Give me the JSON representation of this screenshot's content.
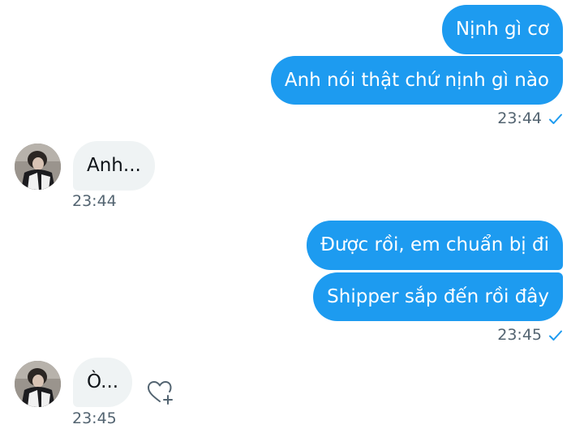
{
  "conversation": {
    "msg1": {
      "text": "Nịnh gì cơ"
    },
    "msg2": {
      "text": "Anh nói thật chứ nịnh gì nào"
    },
    "time1": "23:44",
    "msg3": {
      "text": "Anh..."
    },
    "time2": "23:44",
    "msg4": {
      "text": "Được rồi, em chuẩn bị đi"
    },
    "msg5": {
      "text": "Shipper sắp đến rồi đây"
    },
    "time3": "23:45",
    "msg6": {
      "text": "Ò..."
    },
    "time4": "23:45"
  },
  "colors": {
    "outgoing_bubble": "#1d9bf0",
    "incoming_bubble": "#eff3f4",
    "timestamp": "#536471",
    "read_check": "#1d9bf0"
  },
  "icons": {
    "read_receipt": "check-icon",
    "react": "heart-plus-icon"
  }
}
